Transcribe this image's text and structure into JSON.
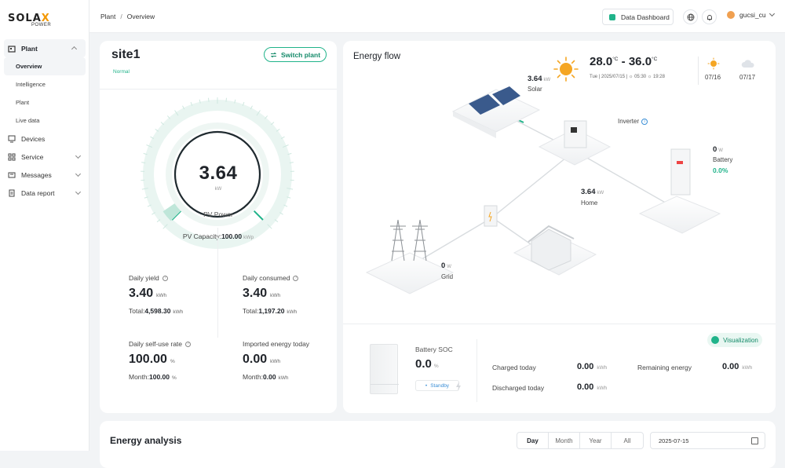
{
  "brand": {
    "logo_text_a": "SOLA",
    "logo_text_b": "X",
    "logo_sub": "POWER"
  },
  "sidebar": {
    "plant": {
      "label": "Plant",
      "icon": "plant-icon",
      "children": [
        "Overview",
        "Intelligence",
        "Plant",
        "Live data"
      ],
      "active": "Overview"
    },
    "items": [
      {
        "label": "Devices",
        "icon": "devices-icon"
      },
      {
        "label": "Service",
        "icon": "service-icon"
      },
      {
        "label": "Messages",
        "icon": "messages-icon"
      },
      {
        "label": "Data report",
        "icon": "report-icon"
      }
    ]
  },
  "header": {
    "breadcrumb": [
      "Plant",
      "Overview"
    ],
    "breadcrumb_sep": "/",
    "dashboard_label": "Data Dashboard",
    "user_name": "gucsi_cu"
  },
  "site": {
    "name": "site1",
    "status": "Normal",
    "switch_label": "Switch plant",
    "pv_value": "3.64",
    "pv_unit": "kW",
    "pv_label": "PV Power",
    "pv_capacity_label": "PV Capacity:",
    "pv_capacity_value": "100.00",
    "pv_capacity_unit": "kWp",
    "gauge_fraction": 0.036,
    "stats": [
      {
        "label": "Daily yield",
        "value": "3.40",
        "unit": "kWh",
        "sub_label": "Total:",
        "sub_value": "4,598.30",
        "sub_unit": "kWh",
        "help": true
      },
      {
        "label": "Daily consumed",
        "value": "3.40",
        "unit": "kWh",
        "sub_label": "Total:",
        "sub_value": "1,197.20",
        "sub_unit": "kWh",
        "help": true
      },
      {
        "label": "Daily self-use rate",
        "value": "100.00",
        "unit": "%",
        "sub_label": "Month:",
        "sub_value": "100.00",
        "sub_unit": "%",
        "help": true
      },
      {
        "label": "Imported energy today",
        "value": "0.00",
        "unit": "kWh",
        "sub_label": "Month:",
        "sub_value": "0.00",
        "sub_unit": "kWh",
        "help": false
      }
    ]
  },
  "energy_flow": {
    "title": "Energy flow",
    "weather": {
      "temp_low": "28.0",
      "temp_high": "36.0",
      "temp_unit": "°C",
      "temp_sep": " - ",
      "date_line": "Tue | 2025/07/15 | ☼ 05:30 ☼ 19:28",
      "forecast": [
        {
          "date": "07/16",
          "icon": "sun-icon"
        },
        {
          "date": "07/17",
          "icon": "cloud-icon"
        }
      ]
    },
    "solar": {
      "value": "3.64",
      "unit": "kW",
      "label": "Solar"
    },
    "inverter": {
      "label": "Inverter"
    },
    "battery": {
      "value": "0",
      "unit": "W",
      "label": "Battery",
      "percent": "0.0%"
    },
    "home": {
      "value": "3.64",
      "unit": "kW",
      "label": "Home"
    },
    "grid": {
      "value": "0",
      "unit": "W",
      "label": "Grid"
    },
    "visualization_label": "Visualization",
    "battery_soc": {
      "label": "Battery SOC",
      "value": "0.0",
      "unit": "%",
      "state": "Standby"
    },
    "rows": [
      {
        "label": "Charged today",
        "value": "0.00",
        "unit": "kWh"
      },
      {
        "label": "Discharged today",
        "value": "0.00",
        "unit": "kWh"
      },
      {
        "label": "Remaining energy",
        "value": "0.00",
        "unit": "kWh"
      }
    ]
  },
  "energy_analysis": {
    "title": "Energy analysis",
    "periods": [
      "Day",
      "Month",
      "Year",
      "All"
    ],
    "active_period": "Day",
    "date": "2025-07-15"
  },
  "colors": {
    "accent": "#20b38a",
    "accent_dark": "#148a69",
    "sun": "#f5a623",
    "link": "#3b8fd6"
  }
}
